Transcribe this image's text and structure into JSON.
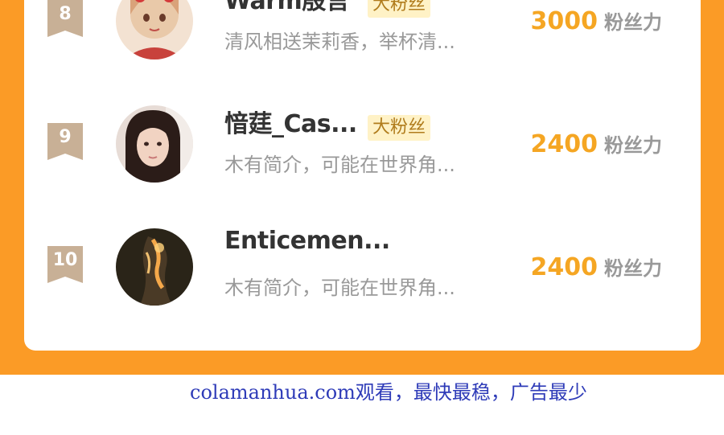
{
  "colors": {
    "orange": "#FB9B26",
    "fans_number": "#F5A623",
    "tag_bg": "#FFF2C6",
    "footer_link": "#2E3BB8"
  },
  "fans_unit": "粉丝力",
  "rows": [
    {
      "rank": "8",
      "name": "Warm殷言",
      "tag": "大粉丝",
      "bio": "清风相送茉莉香，举杯清...",
      "fans": "3000",
      "avatar": "avatar-girl-red-headdress"
    },
    {
      "rank": "9",
      "name": "愔莛_Cas...",
      "tag": "大粉丝",
      "bio": "木有简介，可能在世界角...",
      "fans": "2400",
      "avatar": "avatar-girl-portrait"
    },
    {
      "rank": "10",
      "name": "Enticemen...",
      "tag": "",
      "bio": "木有简介，可能在世界角...",
      "fans": "2400",
      "avatar": "avatar-fire-silhouette"
    }
  ],
  "footer": {
    "text": "colamanhua.com观看，最快最稳，广告最少"
  }
}
